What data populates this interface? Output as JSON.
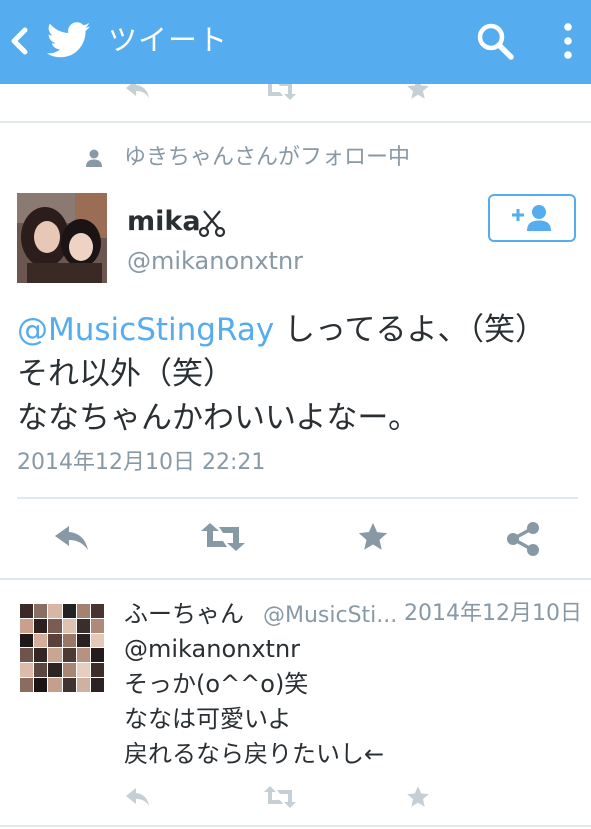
{
  "header": {
    "title": "ツイート",
    "icons": [
      "back-icon",
      "twitter-bird-icon",
      "search-icon",
      "more-icon"
    ],
    "bar_color": "#55acee"
  },
  "social_context": {
    "text": "ゆきちゃんさんがフォロー中",
    "icon": "person-icon"
  },
  "tweet": {
    "author_name": "mika",
    "name_icon": "scissors-icon",
    "handle": "@mikanonxtnr",
    "follow_icon": "add-user-icon",
    "mention": "@MusicStingRay",
    "text_after_mention": " しってるよ、（笑）\nそれ以外（笑）\nななちゃんかわいいよなー。",
    "timestamp": "2014年12月10日 22:21",
    "actions": [
      "reply-icon",
      "retweet-icon",
      "favorite-icon",
      "share-icon"
    ]
  },
  "reply": {
    "name": "ふーちゃん",
    "handle": "@MusicSti...",
    "date": "2014年12月10日",
    "text": "@mikanonxtnr\nそっか(o^^o)笑\nななは可愛いよ\n戻れるなら戻りたいし←",
    "actions": [
      "reply-icon",
      "retweet-icon",
      "favorite-icon"
    ]
  },
  "colors": {
    "accent": "#55acee",
    "text": "#292f33",
    "muted": "#8899a6",
    "divider": "#e1e8ed"
  }
}
